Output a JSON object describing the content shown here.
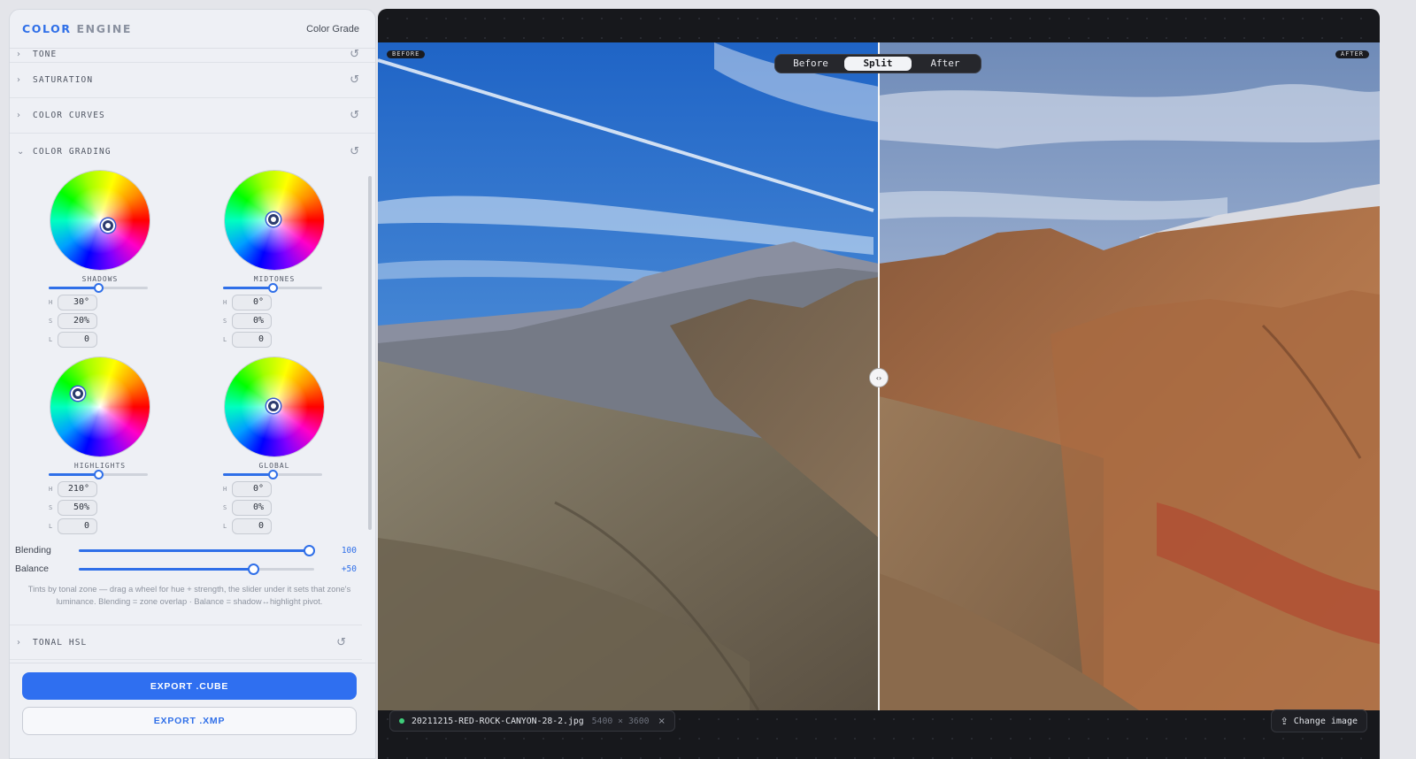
{
  "brand": {
    "part1": "COLOR",
    "part2": "ENGINE"
  },
  "mode_label": "Color Grade",
  "sections": [
    {
      "title": "TONE",
      "expanded": false
    },
    {
      "title": "SATURATION",
      "expanded": false
    },
    {
      "title": "COLOR CURVES",
      "expanded": false
    },
    {
      "title": "COLOR GRADING",
      "expanded": true
    },
    {
      "title": "TONAL HSL",
      "expanded": false
    }
  ],
  "icons": {
    "collapsed": "chevron-right-icon",
    "expanded": "chevron-down-icon",
    "reset": "reset-icon",
    "upload": "upload-icon",
    "close": "close-icon",
    "split_handle": "drag-handle-icon"
  },
  "wheels": [
    {
      "label": "SHADOWS",
      "h_label": "H",
      "s_label": "S",
      "l_label": "L",
      "h": "30°",
      "s": "20%",
      "l": "0",
      "lum_slider": 0.5
    },
    {
      "label": "MIDTONES",
      "h_label": "H",
      "s_label": "S",
      "l_label": "L",
      "h": "0°",
      "s": "0%",
      "l": "0",
      "lum_slider": 0.5
    },
    {
      "label": "HIGHLIGHTS",
      "h_label": "H",
      "s_label": "S",
      "l_label": "L",
      "h": "210°",
      "s": "50%",
      "l": "0",
      "lum_slider": 0.5
    },
    {
      "label": "GLOBAL",
      "h_label": "H",
      "s_label": "S",
      "l_label": "L",
      "h": "0°",
      "s": "0%",
      "l": "0",
      "lum_slider": 0.5
    }
  ],
  "sliders": [
    {
      "label": "Blending",
      "value": "100",
      "fraction": 1.0
    },
    {
      "label": "Balance",
      "value": "+50",
      "fraction": 0.75
    }
  ],
  "hint": "Tints by tonal zone — drag a wheel for hue + strength, the slider under it sets that zone's luminance. Blending = zone overlap · Balance = shadow↔highlight pivot.",
  "buttons": {
    "export_cube": "EXPORT .CUBE",
    "export_xmp": "EXPORT .XMP"
  },
  "viewer": {
    "tag_before": "BEFORE",
    "tag_after": "AFTER",
    "segmented": [
      "Before",
      "Split",
      "After"
    ],
    "segmented_active": "Split",
    "split_position": 0.5,
    "file_name": "20211215-RED-ROCK-CANYON-28-2.jpg",
    "file_dims": "5400 × 3600",
    "close_glyph": "×",
    "change_label": "Change image",
    "handle_glyph": "‹›"
  },
  "colors": {
    "accent": "#2f6fe8",
    "status_dot": "#3fce7a"
  }
}
